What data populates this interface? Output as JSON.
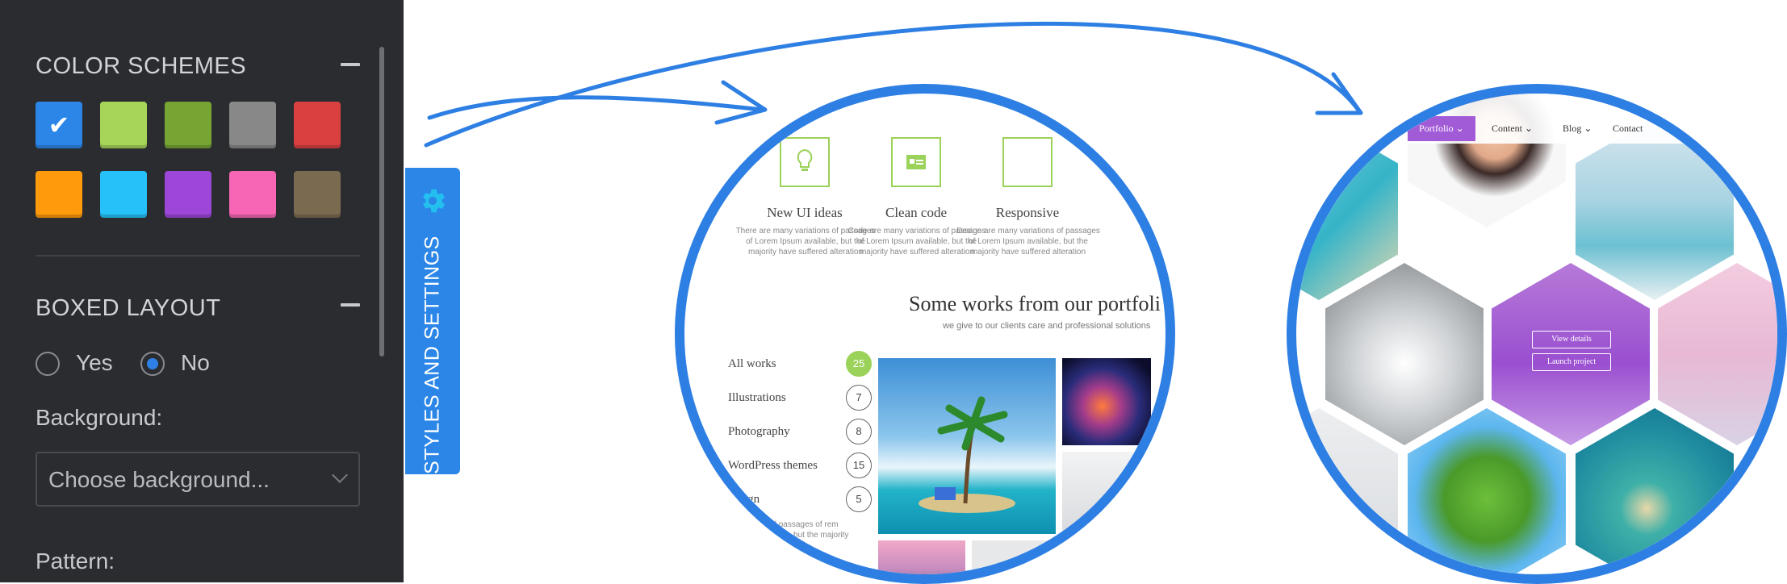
{
  "panel": {
    "color_schemes_title": "COLOR SCHEMES",
    "swatches": [
      {
        "color": "#2b86e8",
        "selected": true
      },
      {
        "color": "#a6d55a",
        "selected": false
      },
      {
        "color": "#76a534",
        "selected": false
      },
      {
        "color": "#888888",
        "selected": false
      },
      {
        "color": "#d94141",
        "selected": false
      },
      {
        "color": "#ff9a0c",
        "selected": false
      },
      {
        "color": "#26c1f8",
        "selected": false
      },
      {
        "color": "#9d47d8",
        "selected": false
      },
      {
        "color": "#f766b4",
        "selected": false
      },
      {
        "color": "#7a6a4f",
        "selected": false
      }
    ],
    "boxed_layout_title": "BOXED LAYOUT",
    "yes_label": "Yes",
    "no_label": "No",
    "boxed_selected": "No",
    "background_label": "Background:",
    "background_placeholder": "Choose background...",
    "pattern_label": "Pattern:"
  },
  "tab": {
    "label": "STYLES AND SETTINGS",
    "icon": "gear-icon"
  },
  "preview1": {
    "features": [
      {
        "title": "New UI ideas",
        "text": "There are many variations of passages of Lorem Ipsum available, but the majority have suffered alteration",
        "icon": "lightbulb-icon"
      },
      {
        "title": "Clean code",
        "text": "Code are many variations of passages of Lorem Ipsum available, but the majority have suffered alteration",
        "icon": "id-card-icon"
      },
      {
        "title": "Responsive",
        "text": "Design are many variations of passages of Lorem Ipsum available, but the majority have suffered alteration",
        "icon": "responsive-icon"
      }
    ],
    "heading": "Some works from our portfoli",
    "subheading": "we give to our clients care and professional solutions",
    "categories": [
      {
        "label": "All works",
        "count": "25",
        "active": true
      },
      {
        "label": "Illustrations",
        "count": "7",
        "active": false
      },
      {
        "label": "Photography",
        "count": "8",
        "active": false
      },
      {
        "label": "WordPress themes",
        "count": "15",
        "active": false
      },
      {
        "label": "design",
        "count": "5",
        "active": false
      }
    ],
    "footer_text": "variations of passages of rem Ipsum available, but the majority"
  },
  "preview2": {
    "nav": [
      {
        "label": "Portfolio",
        "active": true
      },
      {
        "label": "Content",
        "active": false
      },
      {
        "label": "Blog",
        "active": false
      },
      {
        "label": "Contact",
        "active": false
      }
    ],
    "view_details": "View details",
    "launch_project": "Launch project"
  },
  "colors": {
    "accent": "#2e7fe3",
    "panel_bg": "#2b2c30",
    "green": "#9bd25a",
    "purple": "#a25bd6"
  }
}
